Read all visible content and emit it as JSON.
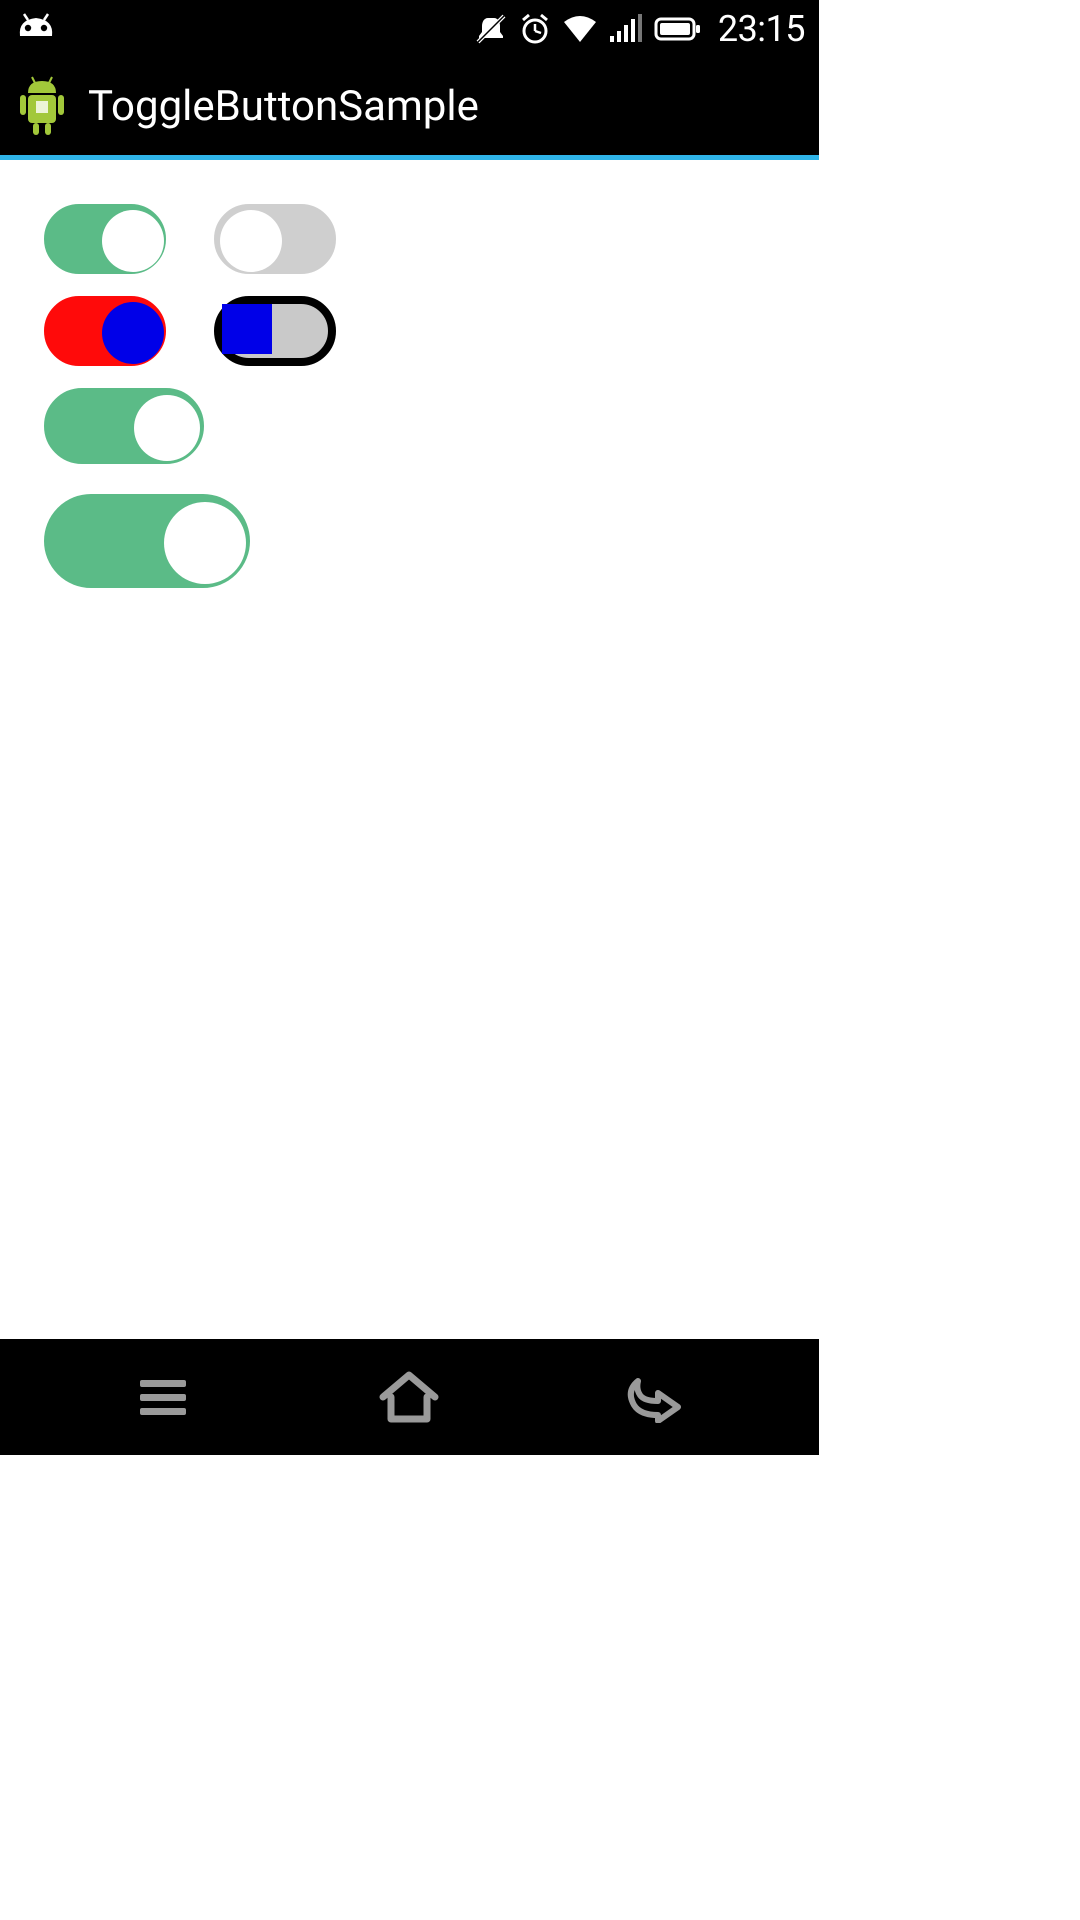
{
  "status_bar": {
    "time": "23:15",
    "icons": {
      "notification": "android-head-icon",
      "vibrate": "vibrate-mute-icon",
      "alarm": "alarm-clock-icon",
      "wifi": "wifi-icon",
      "signal": "signal-4-of-5-icon",
      "battery": "battery-full-icon"
    }
  },
  "action_bar": {
    "title": "ToggleButtonSample",
    "icon": "android-robot-icon"
  },
  "toggles": {
    "row1": [
      {
        "state": "on",
        "track": "#5bbb87",
        "knob": "#ffffff"
      },
      {
        "state": "off",
        "track": "#cfcfcf",
        "knob": "#ffffff"
      }
    ],
    "row2": [
      {
        "state": "on",
        "track": "#ff0a0a",
        "knob": "#0000e8",
        "border": "none"
      },
      {
        "state": "off",
        "track": "#c9c9c9",
        "knob": "#0000e8",
        "border": "#000000"
      }
    ],
    "row3": [
      {
        "state": "on",
        "track": "#5bbb87",
        "knob": "#ffffff",
        "size": "medium"
      }
    ],
    "row4": [
      {
        "state": "on",
        "track": "#5bbb87",
        "knob": "#ffffff",
        "size": "large"
      }
    ]
  },
  "nav_bar": {
    "recent": "menu-icon",
    "home": "home-outline-icon",
    "back": "back-icon"
  },
  "colors": {
    "accent_divider": "#2fb4e8",
    "green": "#5bbb87",
    "red": "#ff0a0a",
    "blue": "#0000e8",
    "grey": "#cfcfcf",
    "black": "#000000",
    "white": "#ffffff"
  }
}
